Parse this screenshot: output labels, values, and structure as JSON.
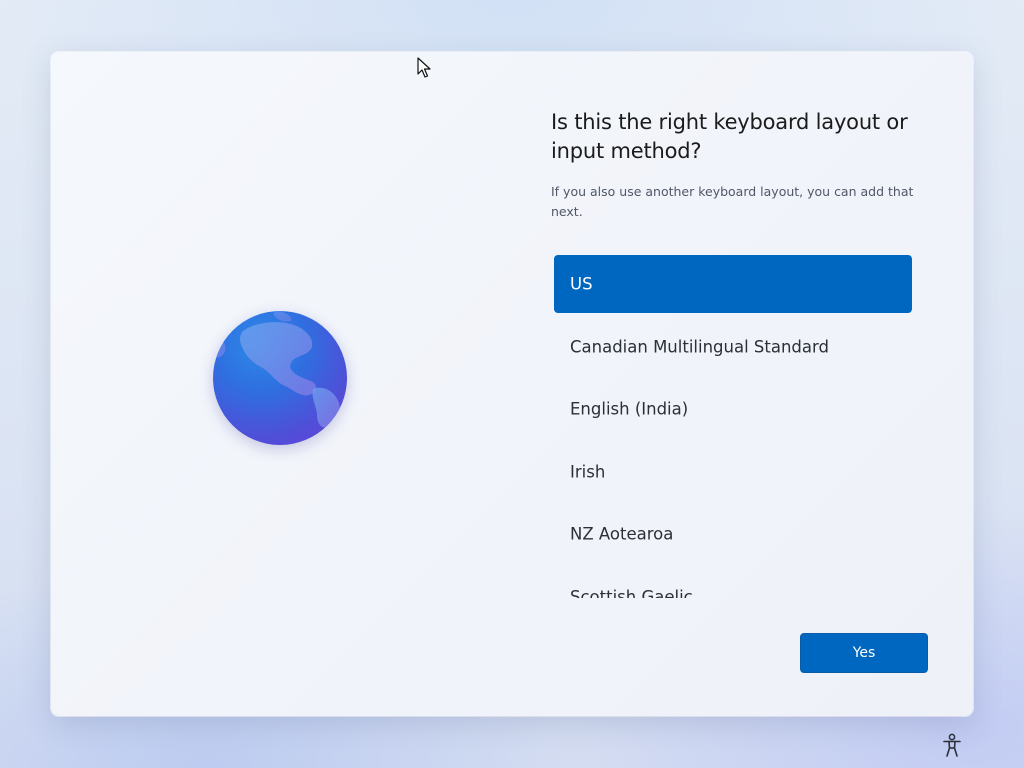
{
  "dialog": {
    "title": "Is this the right keyboard layout or input method?",
    "subtitle": "If you also use another keyboard layout, you can add that next."
  },
  "illustration": {
    "icon": "globe-icon",
    "colors": {
      "top": "#2c8ae8",
      "bottom": "#6a3fd6"
    }
  },
  "keyboard_layouts": {
    "selected_index": 0,
    "items": [
      {
        "label": "US"
      },
      {
        "label": "Canadian Multilingual Standard"
      },
      {
        "label": "English (India)"
      },
      {
        "label": "Irish"
      },
      {
        "label": "NZ Aotearoa"
      },
      {
        "label": "Scottish Gaelic"
      }
    ]
  },
  "actions": {
    "yes_label": "Yes"
  },
  "footer": {
    "icon": "accessibility-icon"
  },
  "colors": {
    "accent": "#0067c0",
    "selected_text": "#ffffff"
  }
}
